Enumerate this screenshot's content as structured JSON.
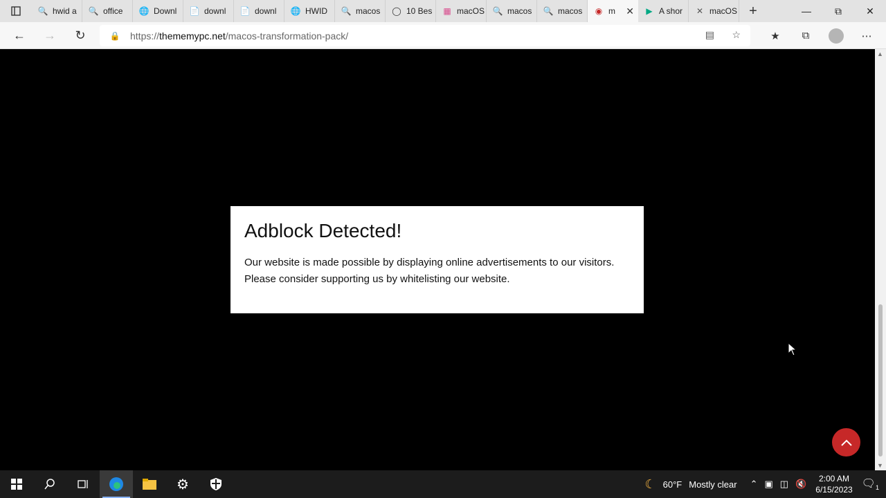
{
  "browser": {
    "tabs": [
      {
        "icon": "search-icon",
        "label": "hwid a"
      },
      {
        "icon": "search-icon",
        "label": "office"
      },
      {
        "icon": "globe-icon",
        "label": "Downl"
      },
      {
        "icon": "document-icon",
        "label": "downl"
      },
      {
        "icon": "document-icon",
        "label": "downl"
      },
      {
        "icon": "globe-icon",
        "label": "HWID"
      },
      {
        "icon": "search-icon",
        "label": "macos"
      },
      {
        "icon": "circle-icon",
        "label": "10 Bes"
      },
      {
        "icon": "app-icon",
        "label": "macOS"
      },
      {
        "icon": "search-icon",
        "label": "macos"
      },
      {
        "icon": "search-icon",
        "label": "macos"
      },
      {
        "icon": "site-icon",
        "label": "m",
        "active": true
      },
      {
        "icon": "play-icon",
        "label": "A shor"
      },
      {
        "icon": "x-icon",
        "label": "macOS"
      }
    ],
    "url_domain": "thememypc.net",
    "url_prefix": "https://",
    "url_path": "/macos-transformation-pack/"
  },
  "modal": {
    "title": "Adblock Detected!",
    "line1": "Our website is made possible by displaying online advertisements to our visitors.",
    "line2": "Please consider supporting us by whitelisting our website."
  },
  "taskbar": {
    "weather_temp": "60°F",
    "weather_desc": "Mostly clear",
    "time": "2:00 AM",
    "date": "6/15/2023",
    "notifications": "1"
  },
  "colors": {
    "back_to_top": "#c62828",
    "page_background": "#000000"
  }
}
